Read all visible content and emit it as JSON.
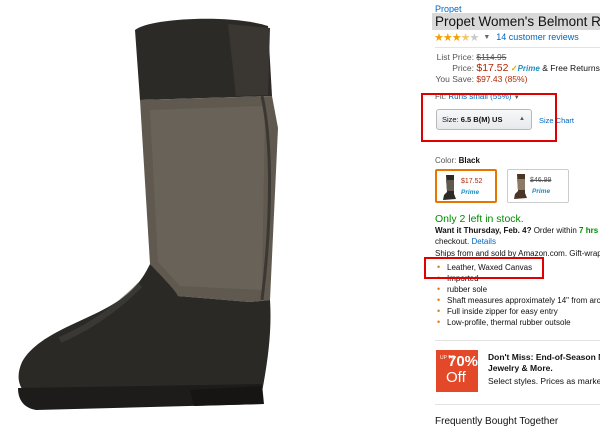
{
  "product": {
    "brand": "Propet",
    "title": "Propet Women's Belmont Ridi",
    "rating": 3.5,
    "reviews_label": "14 customer reviews"
  },
  "pricing": {
    "list_price_label": "List Price:",
    "list_price": "$114.95",
    "price_label": "Price:",
    "price": "$17.52",
    "prime_label": "Prime",
    "free_returns": "& Free Returns.",
    "you_save_label": "You Save:",
    "you_save": "$97.43 (85%)"
  },
  "fit": {
    "label": "Fit:",
    "value": "Runs small (55%)"
  },
  "size": {
    "label": "Size:",
    "value": "6.5 B(M) US",
    "chart_link": "Size Chart"
  },
  "color": {
    "label": "Color:",
    "value": "Black",
    "swatches": [
      {
        "price": "$17.52",
        "prime": "Prime",
        "selected": true
      },
      {
        "price": "$46.99",
        "prime": "Prime",
        "selected": false
      }
    ]
  },
  "availability": {
    "stock": "Only 2 left in stock.",
    "want_it": "Want it Thursday, Feb. 4?",
    "order_within": "Order within",
    "countdown": "7 hrs 2",
    "checkout": "checkout.",
    "details_link": "Details",
    "ships_from": "Ships from and sold by Amazon.com. Gift-wrap"
  },
  "features": [
    "Leather, Waxed Canvas",
    "Imported",
    "rubber sole",
    "Shaft measures approximately 14\" from arch",
    "Full inside zipper for easy entry",
    "Low-profile, thermal rubber outsole"
  ],
  "promo": {
    "badge_up": "UP TO",
    "badge_pct": "70%",
    "badge_off": "Off",
    "title_line1": "Don't Miss: End-of-Season Ma",
    "title_line2": "Jewelry & More.",
    "subtitle": "Select styles. Prices as marked."
  },
  "frequently_bought": "Frequently Bought Together",
  "colors": {
    "link": "#0066c0",
    "price": "#b12704",
    "in_stock": "#008a00",
    "highlight_box": "#e00000",
    "swatch_selected": "#e77600"
  }
}
